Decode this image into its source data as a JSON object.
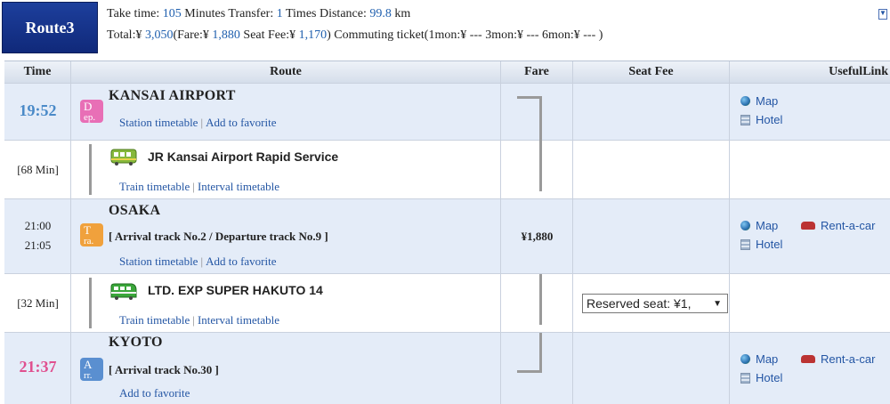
{
  "route": {
    "badge": "Route3",
    "line1": {
      "take_label": "Take time: ",
      "take_value": "105",
      "take_unit": " Minutes  Transfer: ",
      "transfer_value": "1",
      "transfer_unit": " Times  Distance: ",
      "distance_value": "99.8",
      "distance_unit": " km"
    },
    "line2": {
      "total_label": "Total:¥ ",
      "total_value": "3,050",
      "fare_label": "(Fare:¥ ",
      "fare_value": "1,880",
      "seat_label": "  Seat Fee:¥ ",
      "seat_value": "1,170",
      "close": ")",
      "commute": "  Commuting ticket(1mon:¥ ---    3mon:¥ ---    6mon:¥ --- )"
    },
    "collapse_icon": "▼"
  },
  "columns": {
    "time": "Time",
    "route": "Route",
    "fare": "Fare",
    "seat_fee": "Seat Fee",
    "useful": "UsefulLink"
  },
  "stations": [
    {
      "time": "19:52",
      "icon_top": "D",
      "icon_bottom": "ep.",
      "name": "KANSAI AIRPORT",
      "link1": "Station timetable",
      "link2": "Add to favorite",
      "map": "Map",
      "hotel": "Hotel",
      "color": "#4a8ac8",
      "icon_color": "#e86fb6"
    },
    {
      "time_arr": "21:00",
      "time_dep": "21:05",
      "icon_top": "T",
      "icon_bottom": "ra.",
      "name": "OSAKA",
      "track": "[ Arrival track No.2 / Departure track No.9 ]",
      "link1": "Station timetable",
      "link2": "Add to favorite",
      "fare": "¥1,880",
      "map": "Map",
      "hotel": "Hotel",
      "rent": "Rent-a-car",
      "icon_color": "#f0a13c"
    },
    {
      "time": "21:37",
      "icon_top": "A",
      "icon_bottom": "rr.",
      "name": "KYOTO",
      "track": "[ Arrival track No.30 ]",
      "link2": "Add to favorite",
      "map": "Map",
      "hotel": "Hotel",
      "rent": "Rent-a-car",
      "color": "#e0508f",
      "icon_color": "#5a8fd0"
    }
  ],
  "segments": [
    {
      "duration": "[68 Min]",
      "train": "JR Kansai Airport Rapid Service",
      "link1": "Train timetable",
      "link2": "Interval timetable",
      "train_color": "#86b83b"
    },
    {
      "duration": "[32 Min]",
      "train": "LTD. EXP SUPER HAKUTO 14",
      "link1": "Train timetable",
      "link2": "Interval timetable",
      "seat_select": "Reserved seat: ¥1,",
      "train_color": "#3aa63a"
    }
  ]
}
